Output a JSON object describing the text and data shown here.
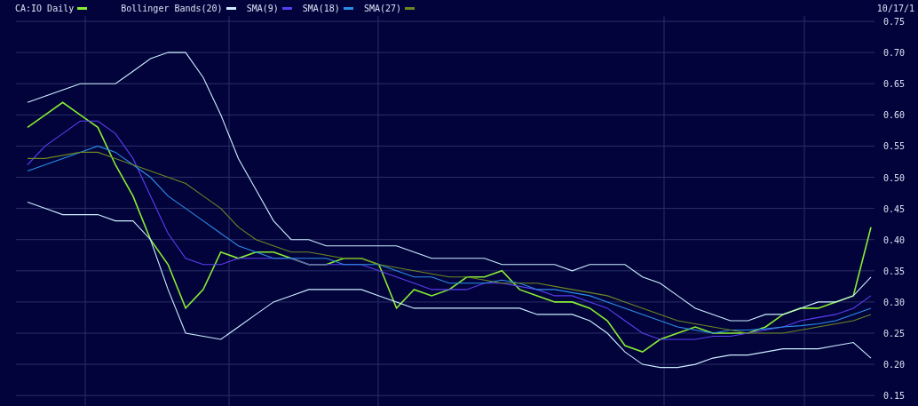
{
  "date_label": "10/17/1",
  "chart_data": {
    "type": "line",
    "grid": true,
    "ylim": [
      0.15,
      0.75
    ],
    "yticks": [
      {
        "value": 0.75,
        "label": "0.75"
      },
      {
        "value": 0.7,
        "label": "0.70"
      },
      {
        "value": 0.65,
        "label": "0.65"
      },
      {
        "value": 0.6,
        "label": "0.60"
      },
      {
        "value": 0.55,
        "label": "0.55"
      },
      {
        "value": 0.5,
        "label": "0.50"
      },
      {
        "value": 0.45,
        "label": "0.45"
      },
      {
        "value": 0.4,
        "label": "0.40"
      },
      {
        "value": 0.35,
        "label": "0.35"
      },
      {
        "value": 0.3,
        "label": "0.30"
      },
      {
        "value": 0.25,
        "label": "0.25"
      },
      {
        "value": 0.2,
        "label": "0.20"
      },
      {
        "value": 0.15,
        "label": "0.15"
      }
    ],
    "series": [
      {
        "name": "CA:IO Daily",
        "color": "#88ee33",
        "values": [
          0.58,
          0.6,
          0.62,
          0.6,
          0.58,
          0.52,
          0.47,
          0.4,
          0.36,
          0.29,
          0.32,
          0.38,
          0.37,
          0.38,
          0.38,
          0.37,
          0.36,
          0.36,
          0.37,
          0.37,
          0.36,
          0.29,
          0.32,
          0.31,
          0.32,
          0.34,
          0.34,
          0.35,
          0.32,
          0.31,
          0.3,
          0.3,
          0.29,
          0.27,
          0.23,
          0.22,
          0.24,
          0.25,
          0.26,
          0.25,
          0.25,
          0.25,
          0.26,
          0.28,
          0.29,
          0.29,
          0.3,
          0.31,
          0.42
        ]
      },
      {
        "name": "Bollinger Bands(20)",
        "color": "#ccf0ff",
        "values": [
          0.62,
          0.63,
          0.64,
          0.65,
          0.65,
          0.65,
          0.67,
          0.69,
          0.7,
          0.7,
          0.66,
          0.6,
          0.53,
          0.48,
          0.43,
          0.4,
          0.4,
          0.39,
          0.39,
          0.39,
          0.39,
          0.39,
          0.38,
          0.37,
          0.37,
          0.37,
          0.37,
          0.36,
          0.36,
          0.36,
          0.36,
          0.35,
          0.36,
          0.36,
          0.36,
          0.34,
          0.33,
          0.31,
          0.29,
          0.28,
          0.27,
          0.27,
          0.28,
          0.28,
          0.29,
          0.3,
          0.3,
          0.31,
          0.34
        ]
      },
      {
        "color": "#ccf0ff",
        "values": [
          0.46,
          0.45,
          0.44,
          0.44,
          0.44,
          0.43,
          0.43,
          0.4,
          0.32,
          0.25,
          0.245,
          0.24,
          0.26,
          0.28,
          0.3,
          0.31,
          0.32,
          0.32,
          0.32,
          0.32,
          0.31,
          0.3,
          0.29,
          0.29,
          0.29,
          0.29,
          0.29,
          0.29,
          0.29,
          0.28,
          0.28,
          0.28,
          0.27,
          0.25,
          0.22,
          0.2,
          0.195,
          0.195,
          0.2,
          0.21,
          0.215,
          0.215,
          0.22,
          0.225,
          0.225,
          0.225,
          0.23,
          0.235,
          0.21
        ]
      },
      {
        "name": "SMA(9)",
        "color": "#5a3ff0",
        "values": [
          0.52,
          0.55,
          0.57,
          0.59,
          0.59,
          0.57,
          0.53,
          0.47,
          0.41,
          0.37,
          0.36,
          0.36,
          0.37,
          0.37,
          0.37,
          0.37,
          0.36,
          0.36,
          0.36,
          0.36,
          0.35,
          0.34,
          0.33,
          0.32,
          0.32,
          0.32,
          0.33,
          0.33,
          0.325,
          0.32,
          0.31,
          0.31,
          0.3,
          0.29,
          0.27,
          0.25,
          0.24,
          0.24,
          0.24,
          0.245,
          0.245,
          0.25,
          0.255,
          0.26,
          0.27,
          0.275,
          0.28,
          0.29,
          0.31
        ]
      },
      {
        "name": "SMA(18)",
        "color": "#2a8fe8",
        "values": [
          0.51,
          0.52,
          0.53,
          0.54,
          0.55,
          0.54,
          0.52,
          0.5,
          0.47,
          0.45,
          0.43,
          0.41,
          0.39,
          0.38,
          0.37,
          0.37,
          0.37,
          0.37,
          0.36,
          0.36,
          0.36,
          0.35,
          0.34,
          0.34,
          0.33,
          0.33,
          0.33,
          0.335,
          0.33,
          0.32,
          0.32,
          0.315,
          0.31,
          0.3,
          0.29,
          0.28,
          0.27,
          0.26,
          0.255,
          0.25,
          0.255,
          0.255,
          0.257,
          0.26,
          0.262,
          0.265,
          0.27,
          0.28,
          0.29
        ]
      },
      {
        "name": "SMA(27)",
        "color": "#6a8a20",
        "values": [
          0.53,
          0.53,
          0.535,
          0.54,
          0.54,
          0.53,
          0.52,
          0.51,
          0.5,
          0.49,
          0.47,
          0.45,
          0.42,
          0.4,
          0.39,
          0.38,
          0.38,
          0.375,
          0.37,
          0.37,
          0.36,
          0.355,
          0.35,
          0.345,
          0.34,
          0.34,
          0.335,
          0.33,
          0.33,
          0.33,
          0.325,
          0.32,
          0.315,
          0.31,
          0.3,
          0.29,
          0.28,
          0.27,
          0.265,
          0.26,
          0.255,
          0.25,
          0.25,
          0.25,
          0.255,
          0.26,
          0.265,
          0.27,
          0.28
        ]
      }
    ]
  }
}
